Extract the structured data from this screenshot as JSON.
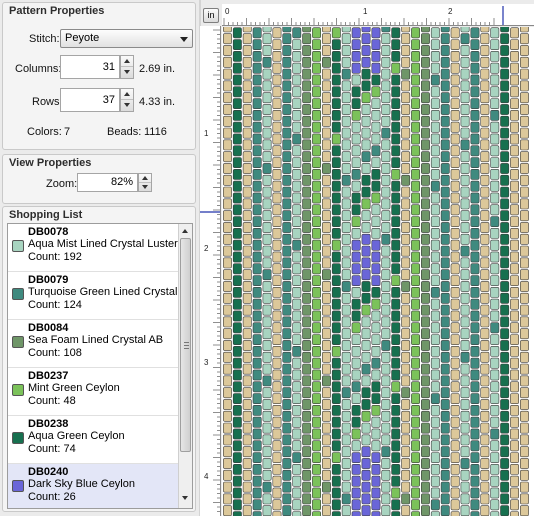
{
  "pattern_properties": {
    "title": "Pattern Properties",
    "stitch_label": "Stitch:",
    "stitch_value": "Peyote",
    "columns_label": "Columns:",
    "columns_value": "31",
    "columns_size": "2.69 in.",
    "rows_label": "Rows:",
    "rows_value": "37",
    "rows_size": "4.33 in.",
    "colors_label": "Colors:",
    "colors_value": "7",
    "beads_label": "Beads:",
    "beads_value": "1116"
  },
  "view_properties": {
    "title": "View Properties",
    "zoom_label": "Zoom:",
    "zoom_value": "82%"
  },
  "shopping_list": {
    "title": "Shopping List",
    "items": [
      {
        "code": "DB0078",
        "name": "Aqua Mist Lined Crystal Luster",
        "count": "Count: 192",
        "color": "#a8d4c0"
      },
      {
        "code": "DB0079",
        "name": "Turquoise Green Lined Crystal ...",
        "count": "Count: 124",
        "color": "#3f8a7f"
      },
      {
        "code": "DB0084",
        "name": "Sea Foam Lined Crystal AB",
        "count": "Count: 108",
        "color": "#6f9668"
      },
      {
        "code": "DB0237",
        "name": "Mint Green Ceylon",
        "count": "Count: 48",
        "color": "#7bc25a"
      },
      {
        "code": "DB0238",
        "name": "Aqua Green Ceylon",
        "count": "Count: 74",
        "color": "#17704f"
      },
      {
        "code": "DB0240",
        "name": "Dark Sky Blue Ceylon",
        "count": "Count: 26",
        "color": "#6a66d8"
      }
    ],
    "selected_index": 5
  },
  "units_button": "in",
  "ruler": {
    "h_labels": [
      "0",
      "1",
      "2"
    ],
    "v_labels": [
      "1",
      "2",
      "3",
      "4"
    ]
  },
  "bead_colors": {
    "A": "#a8d4c0",
    "T": "#3f8a7f",
    "S": "#6f9668",
    "M": "#7bc25a",
    "G": "#17704f",
    "B": "#6a66d8",
    "C": "#dcc89a"
  }
}
